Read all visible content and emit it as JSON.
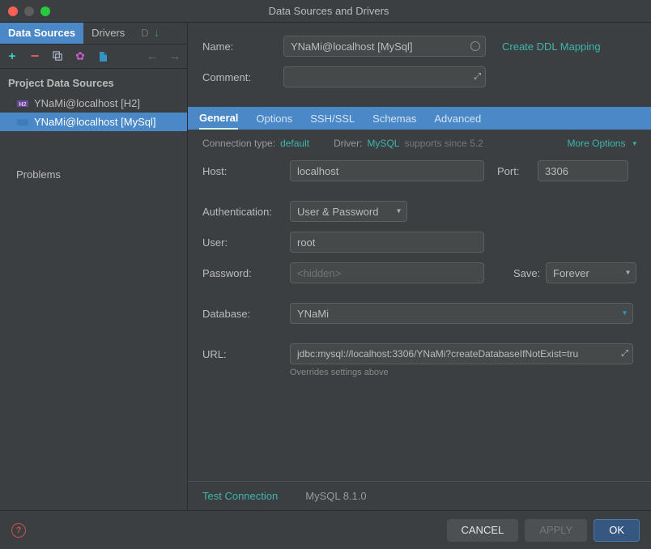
{
  "window": {
    "title": "Data Sources and Drivers"
  },
  "sidebar": {
    "tabs": [
      {
        "label": "Data Sources",
        "active": true
      },
      {
        "label": "Drivers",
        "active": false
      },
      {
        "label": "DDL Mappings",
        "truncated": "DI"
      }
    ],
    "section_title": "Project Data Sources",
    "items": [
      {
        "label": "YNaMi@localhost [H2]",
        "type": "h2",
        "selected": false
      },
      {
        "label": "YNaMi@localhost [MySql]",
        "type": "mysql",
        "selected": true
      }
    ],
    "problems_label": "Problems"
  },
  "header_form": {
    "name_label": "Name:",
    "name_value": "YNaMi@localhost [MySql]",
    "ddl_link": "Create DDL Mapping",
    "comment_label": "Comment:",
    "comment_value": ""
  },
  "sub_tabs": [
    "General",
    "Options",
    "SSH/SSL",
    "Schemas",
    "Advanced"
  ],
  "active_sub_tab": "General",
  "meta": {
    "conn_type_label": "Connection type:",
    "conn_type_value": "default",
    "driver_label": "Driver:",
    "driver_value": "MySQL",
    "driver_support": "supports since 5.2",
    "more_options": "More Options"
  },
  "general": {
    "host_label": "Host:",
    "host_value": "localhost",
    "port_label": "Port:",
    "port_value": "3306",
    "auth_label": "Authentication:",
    "auth_value": "User & Password",
    "user_label": "User:",
    "user_value": "root",
    "password_label": "Password:",
    "password_placeholder": "<hidden>",
    "save_label": "Save:",
    "save_value": "Forever",
    "database_label": "Database:",
    "database_value": "YNaMi",
    "url_label": "URL:",
    "url_value": "jdbc:mysql://localhost:3306/YNaMi?createDatabaseIfNotExist=tru",
    "url_note": "Overrides settings above"
  },
  "footer": {
    "test_connection": "Test Connection",
    "driver_version": "MySQL 8.1.0",
    "cancel": "CANCEL",
    "apply": "APPLY",
    "ok": "OK"
  }
}
